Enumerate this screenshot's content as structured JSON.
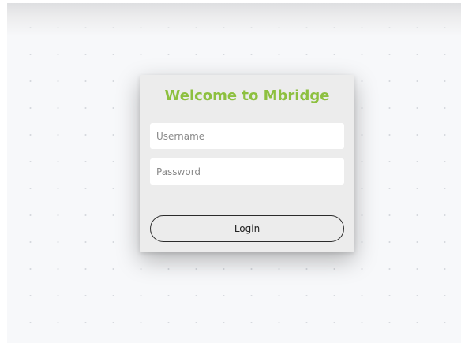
{
  "login": {
    "title": "Welcome to Mbridge",
    "username_placeholder": "Username",
    "password_placeholder": "Password",
    "submit_label": "Login"
  },
  "colors": {
    "title_accent": "#8dc03f",
    "card_background": "#ececec",
    "page_background": "#f7f8fa"
  }
}
